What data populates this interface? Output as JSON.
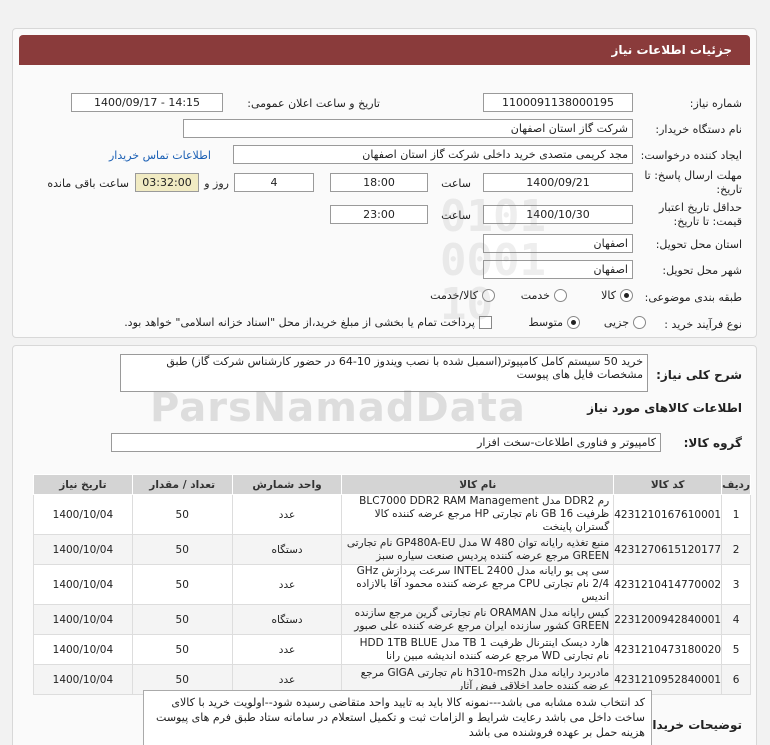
{
  "header": {
    "title": "جزئیات اطلاعات نیاز"
  },
  "form": {
    "need_number_label": "شماره نیاز:",
    "need_number": "1100091138000195",
    "announce_label": "تاریخ و ساعت اعلان عمومی:",
    "announce_value": "1400/09/17 - 14:15",
    "buyer_org_label": "نام دستگاه خریدار:",
    "buyer_org": "شرکت گاز استان اصفهان",
    "creator_label": "ایجاد کننده درخواست:",
    "creator": "مجد کریمی متصدی خرید داخلی شرکت گاز استان اصفهان",
    "contact_link": "اطلاعات تماس خریدار",
    "deadline_label_1": "مهلت ارسال پاسخ: تا",
    "deadline_label_2": "تاریخ:",
    "deadline_date": "1400/09/21",
    "time_label": "ساعت",
    "deadline_time": "18:00",
    "days_value": "4",
    "days_label": "روز و",
    "remaining_time": "03:32:00",
    "remaining_label": "ساعت باقی مانده",
    "validity_label_1": "حداقل تاریخ اعتبار",
    "validity_label_2": "قیمت: تا تاریخ:",
    "validity_date": "1400/10/30",
    "validity_time": "23:00",
    "province_label": "استان محل تحویل:",
    "province": "اصفهان",
    "city_label": "شهر محل تحویل:",
    "city": "اصفهان",
    "category_label": "طبقه بندی موضوعی:",
    "category_options": [
      "کالا",
      "خدمت",
      "کالا/خدمت"
    ],
    "process_label": "نوع فرآیند خرید :",
    "process_options": [
      "جزیی",
      "متوسط"
    ],
    "payment_note": "پرداخت تمام یا بخشی از مبلغ خرید،از محل \"اسناد خزانه اسلامی\" خواهد بود."
  },
  "general": {
    "desc_label": "شرح کلی نیاز:",
    "desc": "خرید 50 سیستم کامل کامپیوتر(اسمبل شده با نصب ویندوز 10-64 در حضور کارشناس شرکت گاز) طبق مشخصات فایل های پیوست",
    "goods_title": "اطلاعات کالاهای مورد نیاز",
    "group_label": "گروه کالا:",
    "group": "کامپیوتر و فناوری اطلاعات-سخت افزار"
  },
  "table": {
    "headers": [
      "ردیف",
      "کد کالا",
      "نام کالا",
      "واحد شمارش",
      "تعداد / مقدار",
      "تاریخ نیاز"
    ],
    "rows": [
      [
        "1",
        "4231210167610001",
        "رم DDR2 مدل BLC7000 DDR2 RAM Management ظرفیت 16 GB نام تجارتی HP مرجع عرضه کننده کالا گستران پاینخت",
        "عدد",
        "50",
        "1400/10/04"
      ],
      [
        "2",
        "4231270615120177",
        "منبع تغذیه رایانه توان 480 W مدل GP480A-EU نام تجارتی GREEN مرجع عرضه کننده پردیس صنعت سیاره سبز",
        "دستگاه",
        "50",
        "1400/10/04"
      ],
      [
        "3",
        "4231210414770002",
        "سی پی یو رایانه مدل INTEL 2400 سرعت پردازش GHz 2/4 نام تجارتی CPU مرجع عرضه کننده محمود آقا بالازاده اندیس",
        "عدد",
        "50",
        "1400/10/04"
      ],
      [
        "4",
        "2231200942840001",
        "کیس رایانه مدل ORAMAN نام تجارتی گرین مرجع سازنده GREEN کشور سازنده ایران مرجع عرضه کننده علی صبور",
        "دستگاه",
        "50",
        "1400/10/04"
      ],
      [
        "5",
        "4231210473180020",
        "هارد دیسک اینترنال ظرفیت 1 TB مدل HDD 1TB BLUE نام تجارتی WD مرجع عرضه کننده اندیشه مبین رانا",
        "عدد",
        "50",
        "1400/10/04"
      ],
      [
        "6",
        "4231210952840001",
        "مادربرد رایانه مدل h310-ms2h نام تجارتی GIGA مرجع عرضه کننده حامد اخلاقی فیض آثار",
        "عدد",
        "50",
        "1400/10/04"
      ]
    ]
  },
  "notes": {
    "label": "توضیحات خریدار:",
    "text": "کد انتخاب شده مشابه می باشد---نمونه کالا باید به تایید واحد متقاضی رسیده شود--اولویت خرید با کالای ساخت داخل می باشد رعایت شرایط و الزامات ثبت و تکمیل استعلام در سامانه ستاد  طبق فرم های پیوست هزینه حمل بر عهده فروشنده می باشد"
  },
  "watermark": {
    "text": "ParsNamadData"
  },
  "colors": {
    "titlebar": "#8a3b3b",
    "link": "#1a5fb4",
    "remaining_bg": "#f1ebc3",
    "table_header": "#d4d4d4"
  }
}
